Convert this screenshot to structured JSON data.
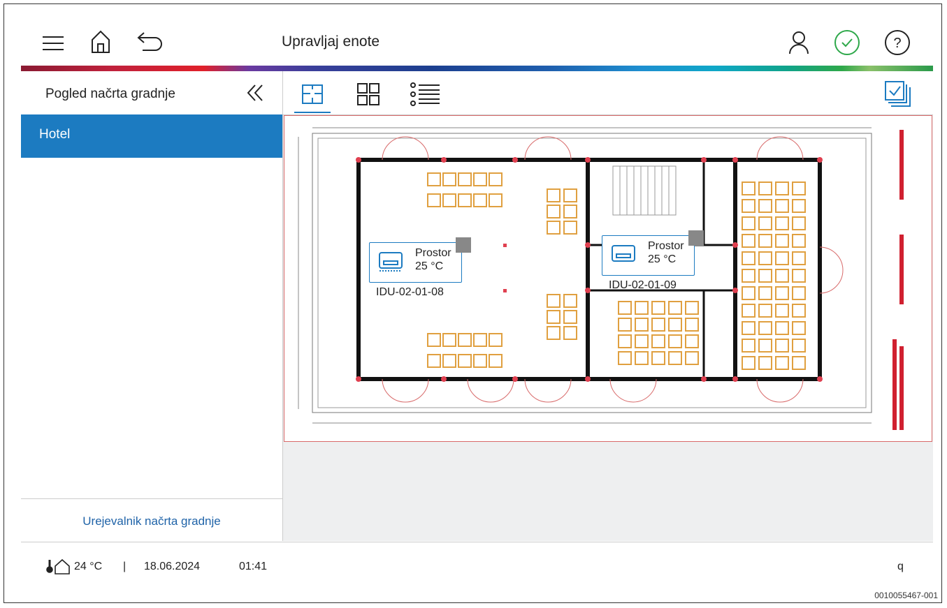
{
  "header": {
    "title": "Upravljaj enote"
  },
  "sidebar": {
    "title": "Pogled načrta gradnje",
    "items": [
      {
        "label": "Hotel",
        "selected": true
      }
    ],
    "footer_link": "Urejevalnik načrta gradnje"
  },
  "view_tabs": [
    {
      "icon": "floor-plan-icon",
      "active": true
    },
    {
      "icon": "grid-view-icon",
      "active": false
    },
    {
      "icon": "list-view-icon",
      "active": false
    }
  ],
  "units": [
    {
      "name": "Prostor",
      "temp": "25 °C",
      "id": "IDU-02-01-08"
    },
    {
      "name": "Prostor",
      "temp": "25 °C",
      "id": "IDU-02-01-09"
    }
  ],
  "status": {
    "outdoor_temp": "24 °C",
    "separator": "|",
    "date": "18.06.2024",
    "time": "01:41",
    "right_label": "q"
  },
  "doc_id": "0010055467-001",
  "colors": {
    "accent": "#1c7bc1",
    "ok": "#2ea84a"
  }
}
